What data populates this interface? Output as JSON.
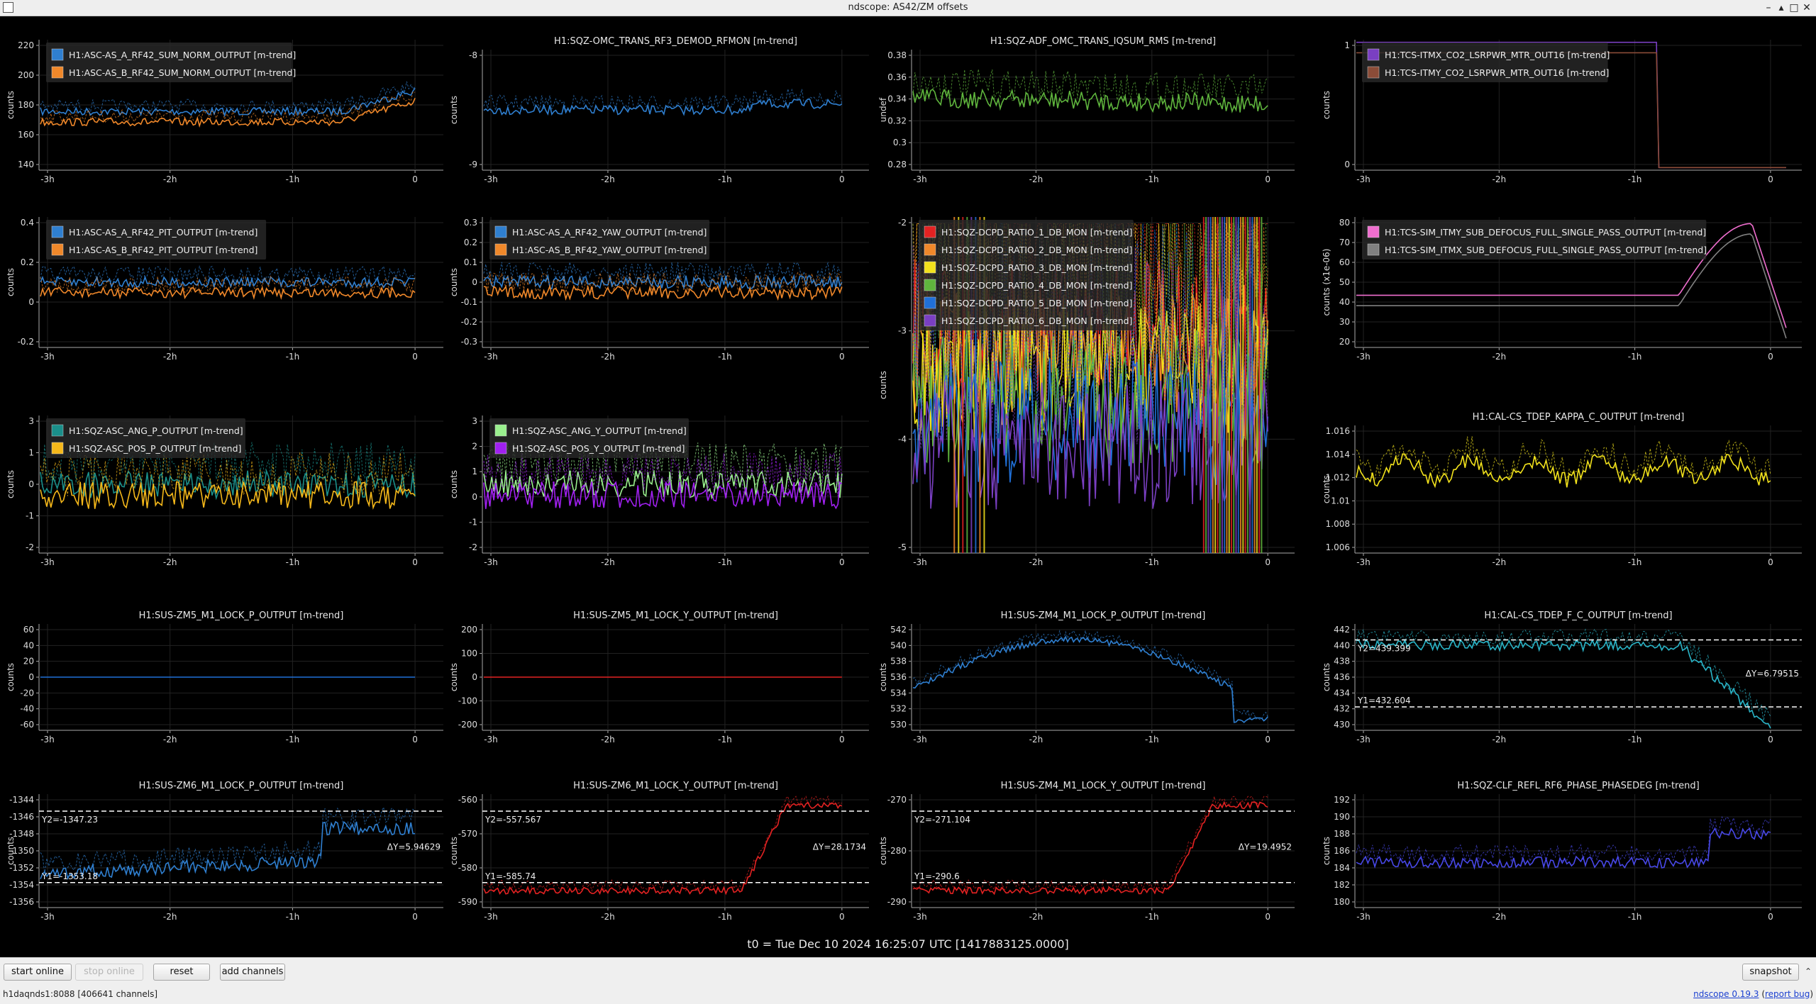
{
  "window": {
    "title": "ndscope: AS42/ZM offsets",
    "controls": {
      "minimize": "–",
      "maximize": "▴",
      "restore": "□",
      "close": "✕"
    }
  },
  "colors": {
    "blue": "#2f7fd0",
    "orange": "#f0882a",
    "green": "#5fb53d",
    "yellow": "#f2e21c",
    "red": "#e32222",
    "purple": "#7a3fc2",
    "teal": "#1a8f8a",
    "gold": "#f5b81a",
    "lightgreen": "#9af08e",
    "violet": "#a020f0",
    "pink": "#f06ecf",
    "brown": "#8b4c38",
    "cyan": "#2ab5c8",
    "indigo": "#4848e8",
    "gray": "#808080",
    "dblue": "#2070d8"
  },
  "plots": [
    {
      "id": "p1",
      "title": "",
      "ylabel": "counts",
      "yticks": [
        "220",
        "200",
        "180",
        "160",
        "140"
      ],
      "legend": [
        {
          "label": "H1:ASC-AS_A_RF42_SUM_NORM_OUTPUT [m-trend]",
          "color": "blue"
        },
        {
          "label": "H1:ASC-AS_B_RF42_SUM_NORM_OUTPUT [m-trend]",
          "color": "orange"
        }
      ]
    },
    {
      "id": "p2",
      "title": "H1:SQZ-OMC_TRANS_RF3_DEMOD_RFMON [m-trend]",
      "ylabel": "counts",
      "yticks": [
        "-8",
        "-9"
      ],
      "legend": []
    },
    {
      "id": "p3",
      "title": "H1:SQZ-ADF_OMC_TRANS_IQSUM_RMS [m-trend]",
      "ylabel": "undef",
      "yticks": [
        "0.38",
        "0.36",
        "0.34",
        "0.32",
        "0.3",
        "0.28"
      ],
      "legend": []
    },
    {
      "id": "p4",
      "title": "",
      "ylabel": "counts",
      "yticks": [
        "1",
        "0"
      ],
      "legend": [
        {
          "label": "H1:TCS-ITMX_CO2_LSRPWR_MTR_OUT16 [m-trend]",
          "color": "purple"
        },
        {
          "label": "H1:TCS-ITMY_CO2_LSRPWR_MTR_OUT16 [m-trend]",
          "color": "brown"
        }
      ]
    },
    {
      "id": "p5",
      "title": "",
      "ylabel": "counts",
      "yticks": [
        "0.4",
        "0.2",
        "0",
        "-0.2"
      ],
      "legend": [
        {
          "label": "H1:ASC-AS_A_RF42_PIT_OUTPUT [m-trend]",
          "color": "blue"
        },
        {
          "label": "H1:ASC-AS_B_RF42_PIT_OUTPUT [m-trend]",
          "color": "orange"
        }
      ]
    },
    {
      "id": "p6",
      "title": "",
      "ylabel": "counts",
      "yticks": [
        "0.3",
        "0.2",
        "0.1",
        "0",
        "-0.1",
        "-0.2",
        "-0.3"
      ],
      "legend": [
        {
          "label": "H1:ASC-AS_A_RF42_YAW_OUTPUT [m-trend]",
          "color": "blue"
        },
        {
          "label": "H1:ASC-AS_B_RF42_YAW_OUTPUT [m-trend]",
          "color": "orange"
        }
      ]
    },
    {
      "id": "p7",
      "title": "",
      "ylabel": "counts",
      "yticks": [
        "-2",
        "-3",
        "-4",
        "-5"
      ],
      "legend": [
        {
          "label": "H1:SQZ-DCPD_RATIO_1_DB_MON [m-trend]",
          "color": "red"
        },
        {
          "label": "H1:SQZ-DCPD_RATIO_2_DB_MON [m-trend]",
          "color": "orange"
        },
        {
          "label": "H1:SQZ-DCPD_RATIO_3_DB_MON [m-trend]",
          "color": "yellow"
        },
        {
          "label": "H1:SQZ-DCPD_RATIO_4_DB_MON [m-trend]",
          "color": "green"
        },
        {
          "label": "H1:SQZ-DCPD_RATIO_5_DB_MON [m-trend]",
          "color": "dblue"
        },
        {
          "label": "H1:SQZ-DCPD_RATIO_6_DB_MON [m-trend]",
          "color": "purple"
        }
      ]
    },
    {
      "id": "p8",
      "title": "",
      "ylabel": "counts (x1e-06)",
      "yticks": [
        "80",
        "70",
        "60",
        "50",
        "40",
        "30",
        "20"
      ],
      "legend": [
        {
          "label": "H1:TCS-SIM_ITMY_SUB_DEFOCUS_FULL_SINGLE_PASS_OUTPUT [m-trend]",
          "color": "pink"
        },
        {
          "label": "H1:TCS-SIM_ITMX_SUB_DEFOCUS_FULL_SINGLE_PASS_OUTPUT [m-trend]",
          "color": "gray"
        }
      ]
    },
    {
      "id": "p9",
      "title": "",
      "ylabel": "counts",
      "yticks": [
        "3",
        "1",
        "0",
        "-1",
        "-2"
      ],
      "legend": [
        {
          "label": "H1:SQZ-ASC_ANG_P_OUTPUT [m-trend]",
          "color": "teal"
        },
        {
          "label": "H1:SQZ-ASC_POS_P_OUTPUT [m-trend]",
          "color": "gold"
        }
      ]
    },
    {
      "id": "p10",
      "title": "",
      "ylabel": "counts",
      "yticks": [
        "3",
        "2",
        "1",
        "0",
        "-1",
        "-2"
      ],
      "legend": [
        {
          "label": "H1:SQZ-ASC_ANG_Y_OUTPUT [m-trend]",
          "color": "lightgreen"
        },
        {
          "label": "H1:SQZ-ASC_POS_Y_OUTPUT [m-trend]",
          "color": "violet"
        }
      ]
    },
    {
      "id": "p11",
      "title": "H1:CAL-CS_TDEP_KAPPA_C_OUTPUT [m-trend]",
      "ylabel": "counts",
      "yticks": [
        "1.016",
        "1.014",
        "1.012",
        "1.01",
        "1.008",
        "1.006"
      ],
      "legend": []
    },
    {
      "id": "p12",
      "title": "H1:SUS-ZM5_M1_LOCK_P_OUTPUT [m-trend]",
      "ylabel": "counts",
      "yticks": [
        "60",
        "40",
        "20",
        "0",
        "-20",
        "-40",
        "-60"
      ],
      "legend": []
    },
    {
      "id": "p13",
      "title": "H1:SUS-ZM5_M1_LOCK_Y_OUTPUT [m-trend]",
      "ylabel": "counts",
      "yticks": [
        "200",
        "100",
        "0",
        "-100",
        "-200"
      ],
      "legend": []
    },
    {
      "id": "p14",
      "title": "H1:SUS-ZM4_M1_LOCK_P_OUTPUT [m-trend]",
      "ylabel": "counts",
      "yticks": [
        "542",
        "540",
        "538",
        "536",
        "534",
        "532",
        "530"
      ],
      "legend": []
    },
    {
      "id": "p15",
      "title": "H1:CAL-CS_TDEP_F_C_OUTPUT [m-trend]",
      "ylabel": "counts",
      "yticks": [
        "442",
        "440",
        "438",
        "436",
        "434",
        "432",
        "430"
      ],
      "legend": [],
      "cursors": {
        "y2": "Y2=439.399",
        "y1": "Y1=432.604",
        "dy": "ΔY=6.79515"
      }
    },
    {
      "id": "p16",
      "title": "H1:SUS-ZM6_M1_LOCK_P_OUTPUT [m-trend]",
      "ylabel": "counts",
      "yticks": [
        "-1344",
        "-1346",
        "-1348",
        "-1350",
        "-1352",
        "-1354",
        "-1356"
      ],
      "legend": [],
      "cursors": {
        "y2": "Y2=-1347.23",
        "y1": "Y1=-1353.18",
        "dy": "ΔY=5.94629"
      }
    },
    {
      "id": "p17",
      "title": "H1:SUS-ZM6_M1_LOCK_Y_OUTPUT [m-trend]",
      "ylabel": "counts",
      "yticks": [
        "-560",
        "-570",
        "-580",
        "-590"
      ],
      "legend": [],
      "cursors": {
        "y2": "Y2=-557.567",
        "y1": "Y1=-585.74",
        "dy": "ΔY=28.1734"
      }
    },
    {
      "id": "p18",
      "title": "H1:SUS-ZM4_M1_LOCK_Y_OUTPUT [m-trend]",
      "ylabel": "counts",
      "yticks": [
        "-270",
        "-280",
        "-290"
      ],
      "legend": [],
      "cursors": {
        "y2": "Y2=-271.104",
        "y1": "Y1=-290.6",
        "dy": "ΔY=19.4952"
      }
    },
    {
      "id": "p19",
      "title": "H1:SQZ-CLF_REFL_RF6_PHASE_PHASEDEG [m-trend]",
      "ylabel": "counts",
      "yticks": [
        "192",
        "190",
        "188",
        "186",
        "184",
        "182",
        "180"
      ],
      "legend": []
    }
  ],
  "xticks": [
    "-3h",
    "-2h",
    "-1h",
    "0"
  ],
  "t0": "t0 = Tue Dec 10 2024 16:25:07 UTC [1417883125.0000]",
  "bottombar": {
    "start_online": "start online",
    "stop_online": "stop online",
    "reset": "reset",
    "add_channels": "add channels",
    "snapshot": "snapshot",
    "collapse": "⌃",
    "status": "h1daqnds1:8088 [406641 channels]",
    "version_link": "ndscope 0.19.3",
    "report_bug": "report bug"
  }
}
